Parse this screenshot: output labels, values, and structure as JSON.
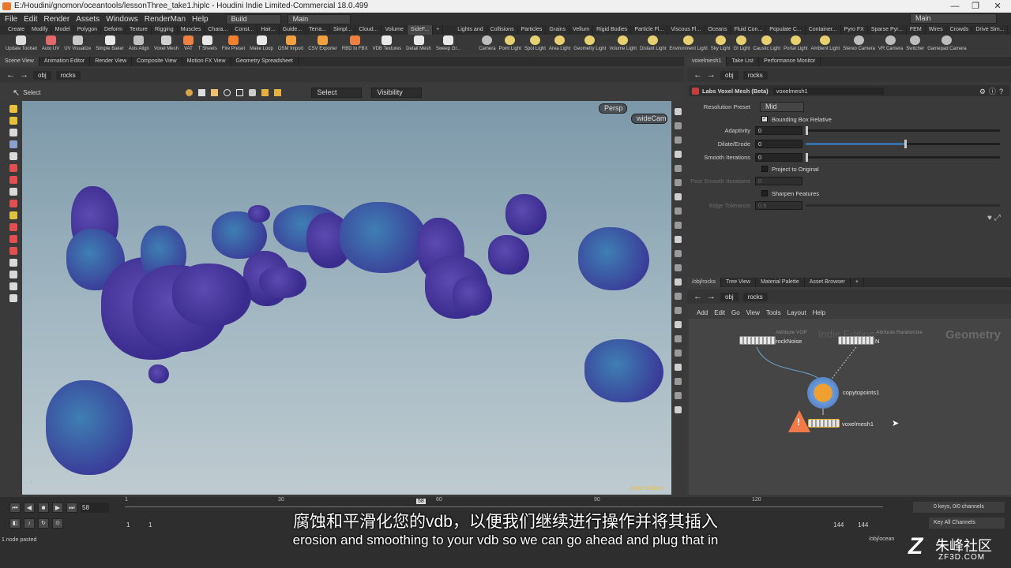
{
  "window": {
    "title": "E:/Houdini/gnomon/oceantools/lessonThree_take1.hiplc - Houdini Indie Limited-Commercial 18.0.499",
    "min_glyph": "—",
    "max_glyph": "❐",
    "close_glyph": "✕"
  },
  "menubar": {
    "items": [
      "File",
      "Edit",
      "Render",
      "Assets",
      "Windows",
      "RenderMan",
      "Help"
    ],
    "desktop": "Build",
    "desktop_main": "Main",
    "right_main": "Main"
  },
  "shelf_tabs": {
    "left": [
      "Create",
      "Modify",
      "Model",
      "Polygon",
      "Deform",
      "Texture",
      "Rigging",
      "Muscles",
      "Chara...",
      "Const...",
      "Hair...",
      "Guide...",
      "Terra...",
      "Simpl...",
      "Cloud...",
      "Volume",
      "SideF..."
    ],
    "active": "SideF...",
    "right": [
      "Lights and",
      "Collisions",
      "Particles",
      "Grains",
      "Vellum",
      "Rigid Bodies",
      "Particle Fl...",
      "Viscous Fl...",
      "Oceans",
      "Fluid Con...",
      "Populate C...",
      "Container...",
      "Pyro FX",
      "Sparse Pyr...",
      "FEM",
      "Wires",
      "Crowds",
      "Drive Sim..."
    ]
  },
  "shelf_tools": {
    "left": [
      "Update Toolset",
      "Auto UV",
      "UV Visualize",
      "Simple Baker",
      "Axis Align",
      "Voxel Mesh",
      "VAT",
      "T Sheets",
      "Fire Preset",
      "Make Loop",
      "OSM Import",
      "CSV Exporter",
      "RBD to FBX",
      "VDB Textures",
      "Detail Mesh",
      "Sweep Gr..."
    ],
    "right": [
      "Camera",
      "Point Light",
      "Spot Light",
      "Area Light",
      "Geometry Light",
      "Volume Light",
      "Distant Light",
      "Environment Light",
      "Sky Light",
      "GI Light",
      "Caustic Light",
      "Portal Light",
      "Ambient Light",
      "Stereo Camera",
      "VR Camera",
      "Switcher",
      "Gamepad Camera"
    ]
  },
  "left_panel": {
    "tabs": [
      "Scene View",
      "Animation Editor",
      "Render View",
      "Composite View",
      "Motion FX View",
      "Geometry Spreadsheet"
    ],
    "path_obj": "obj",
    "path_node": "rocks",
    "select_label": "Select",
    "select_mode": "Select",
    "visibility": "Visibility",
    "persp": "Persp",
    "camera": "wideCam",
    "indie_badge": "Indie Edition"
  },
  "param_panel": {
    "tabs": [
      "voxelmesh1",
      "Take List",
      "Performance Monitor"
    ],
    "path_obj": "obj",
    "path_node": "rocks",
    "node_type": "Labs Voxel Mesh (Beta)",
    "node_name": "voxelmesh1",
    "resolution_preset_label": "Resolution Preset",
    "resolution_preset": "Mid",
    "bbox_relative": "Bounding Box Relative",
    "adaptivity_label": "Adaptivity",
    "adaptivity": "0",
    "dilate_label": "Dilate/Erode",
    "dilate": "0",
    "dilate_fraction": 0.51,
    "smooth_label": "Smooth Iterations",
    "smooth": "0",
    "project_label": "Project to Original",
    "post_smooth_label": "Post Smooth Iterations",
    "post_smooth": "0",
    "sharpen_label": "Sharpen Features",
    "edge_tol_label": "Edge Tolerance",
    "edge_tol": "0.5"
  },
  "network_panel": {
    "tabs": [
      "/obj/rocks",
      "Tree View",
      "Material Palette",
      "Asset Browser"
    ],
    "path_obj": "obj",
    "path_node": "rocks",
    "menu": [
      "Add",
      "Edit",
      "Go",
      "View",
      "Tools",
      "Layout",
      "Help"
    ],
    "watermark": "Indie Edition",
    "context_label": "Geometry",
    "nodes": {
      "rocknoise_type": "Attribute VOP",
      "rocknoise_name": "rockNoise",
      "randomize_type": "Attribute Randomize",
      "randomize_name": "N",
      "copy_name": "copytopoints1",
      "voxel_name": "voxelmesh1"
    }
  },
  "timeline": {
    "frame": "58",
    "ticks": [
      "1",
      "30",
      "60",
      "90",
      "120"
    ],
    "current_marker": "58",
    "start": "1",
    "start2": "1",
    "end": "144",
    "end2": "144",
    "keys": "0 keys, 0/0 channels",
    "key_all": "Key All Channels",
    "status": "1 node pasted",
    "obj_path": "/obj/ocean"
  },
  "subtitles": {
    "zh": "腐蚀和平滑化您的vdb，以便我们继续进行操作并将其插入",
    "en": "erosion and smoothing to your vdb so we can go ahead and plug that in"
  },
  "watermark": {
    "logo": "Z",
    "name": "朱峰社区",
    "url": "ZF3D.COM"
  }
}
